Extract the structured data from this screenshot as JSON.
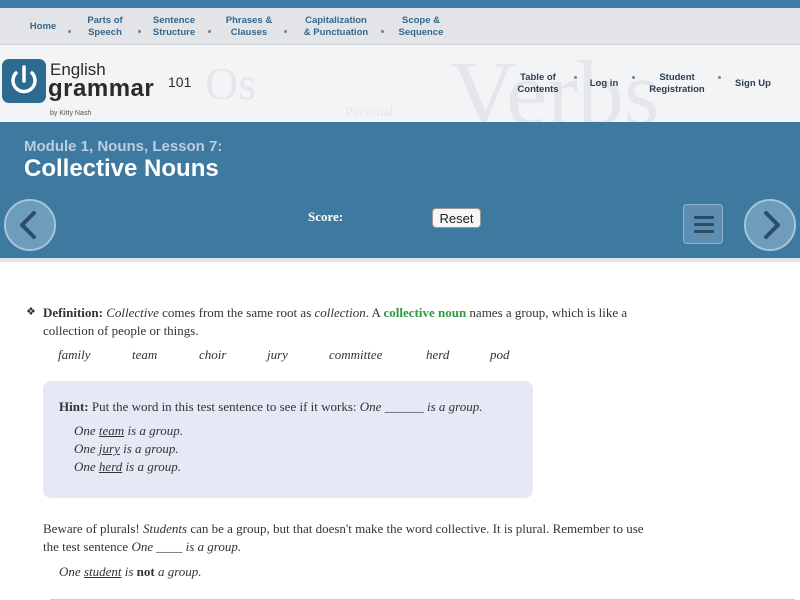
{
  "topnav": {
    "items": [
      {
        "label": "Home"
      },
      {
        "label": "Parts of\nSpeech"
      },
      {
        "label": "Sentence\nStructure"
      },
      {
        "label": "Phrases &\nClauses"
      },
      {
        "label": "Capitalization\n& Punctuation"
      },
      {
        "label": "Scope &\nSequence"
      }
    ]
  },
  "header": {
    "logo_english": "English",
    "logo_grammar": "grammar",
    "logo_101": "101",
    "byline": "by Kitty Nash",
    "nav": [
      {
        "label": "Table of\nContents"
      },
      {
        "label": "Log in"
      },
      {
        "label": "Student\nRegistration"
      },
      {
        "label": "Sign Up"
      }
    ]
  },
  "banner": {
    "module": "Module 1, Nouns, Lesson 7:",
    "title": "Collective Nouns",
    "score_label": "Score:",
    "reset_label": "Reset"
  },
  "content": {
    "definition": {
      "label": "Definition:",
      "t1": "Collective",
      "t2": " comes from the same root as ",
      "t3": "collection",
      "t4": ". A ",
      "term": "collective noun",
      "t5": " names a group, which is like a",
      "line2": "collection of people or things."
    },
    "examples": [
      "family",
      "team",
      "choir",
      "jury",
      "committee",
      "herd",
      "pod"
    ],
    "hint": {
      "label": "Hint:",
      "text": " Put the word in this test sentence to see if it works: ",
      "test_a": "One",
      "test_blank": " ______ ",
      "test_b": "is a group.",
      "examples": [
        {
          "pre": "One ",
          "word": "team",
          "post": " is a group."
        },
        {
          "pre": "One ",
          "word": "jury",
          "post": " is a group."
        },
        {
          "pre": "One ",
          "word": "herd",
          "post": " is a group."
        }
      ]
    },
    "beware": {
      "a": "Beware of plurals! ",
      "students": "Students",
      "b": " can be a group, but that doesn't make the word collective. It is plural. Remember to use",
      "c": "the test sentence ",
      "one": "One",
      "blank": " ____ ",
      "group": "is a group."
    },
    "student_line": {
      "pre": "One ",
      "word": "student",
      "mid": " is ",
      "not": "not",
      "post": " a group."
    }
  },
  "colors": {
    "banner": "#3e7aa0",
    "green_term": "#2e9a3f",
    "hint_bg": "#e5e8f5",
    "nav_text": "#34688c"
  }
}
